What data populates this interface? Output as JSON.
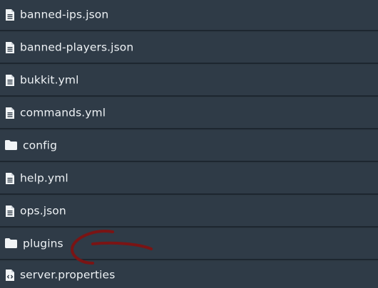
{
  "files": [
    {
      "name": "banned-ips.json",
      "type": "file",
      "icon": "file-icon"
    },
    {
      "name": "banned-players.json",
      "type": "file",
      "icon": "file-icon"
    },
    {
      "name": "bukkit.yml",
      "type": "file",
      "icon": "file-icon"
    },
    {
      "name": "commands.yml",
      "type": "file",
      "icon": "file-icon"
    },
    {
      "name": "config",
      "type": "folder",
      "icon": "folder-icon"
    },
    {
      "name": "help.yml",
      "type": "file",
      "icon": "file-icon"
    },
    {
      "name": "ops.json",
      "type": "file",
      "icon": "file-icon"
    },
    {
      "name": "plugins",
      "type": "folder",
      "icon": "folder-icon"
    },
    {
      "name": "server.properties",
      "type": "file",
      "icon": "file-code-icon"
    }
  ],
  "colors": {
    "background": "#2f3b47",
    "divider": "#1d262f",
    "text": "#eef2f5",
    "annotation": "#8b1a1a"
  }
}
